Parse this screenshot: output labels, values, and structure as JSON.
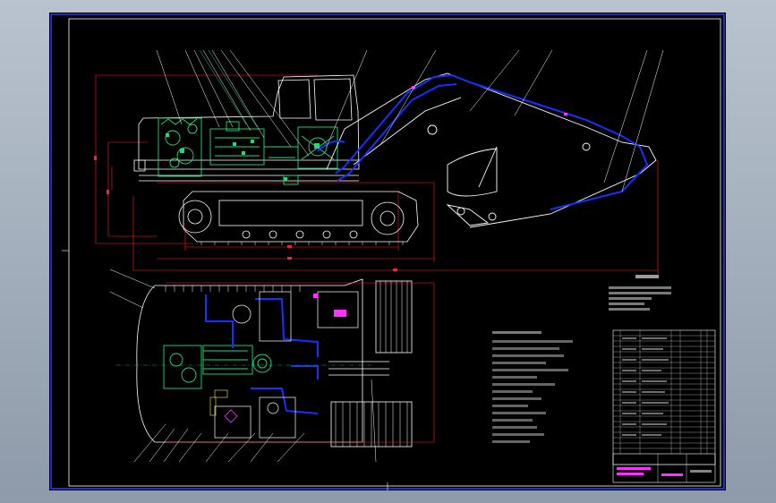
{
  "drawing": {
    "colors": {
      "background": "#000000",
      "frame": "#ffffff",
      "border": "#2a3cff",
      "outline": "#ffffff",
      "dimension": "#ff2222",
      "hydraulic": "#1730ff",
      "component": "#22dd77",
      "accent": "#ff33ff",
      "yellow": "#ffee44"
    }
  }
}
